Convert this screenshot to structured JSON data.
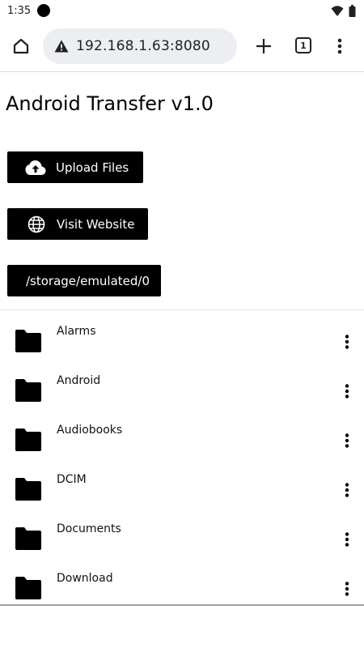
{
  "status_bar": {
    "time": "1:35",
    "icons": [
      "notification-dot-icon",
      "wifi-icon",
      "battery-icon"
    ]
  },
  "browser": {
    "url": "192.168.1.63:8080",
    "security_icon": "warning-triangle-icon",
    "tab_count": "1",
    "buttons": [
      "home-icon",
      "plus-icon",
      "tabs-icon",
      "more-vert-icon"
    ]
  },
  "page": {
    "title": "Android Transfer v1.0",
    "upload_label": "Upload Files",
    "website_label": "Visit Website",
    "path_label": "/storage/emulated/0"
  },
  "files": [
    {
      "name": "Alarms",
      "icon": "folder-icon"
    },
    {
      "name": "Android",
      "icon": "folder-icon"
    },
    {
      "name": "Audiobooks",
      "icon": "folder-icon"
    },
    {
      "name": "DCIM",
      "icon": "folder-icon"
    },
    {
      "name": "Documents",
      "icon": "folder-icon"
    },
    {
      "name": "Download",
      "icon": "folder-icon"
    }
  ],
  "colors": {
    "button_bg": "#000000",
    "button_text": "#ffffff",
    "url_bar_bg": "#eceef1"
  }
}
